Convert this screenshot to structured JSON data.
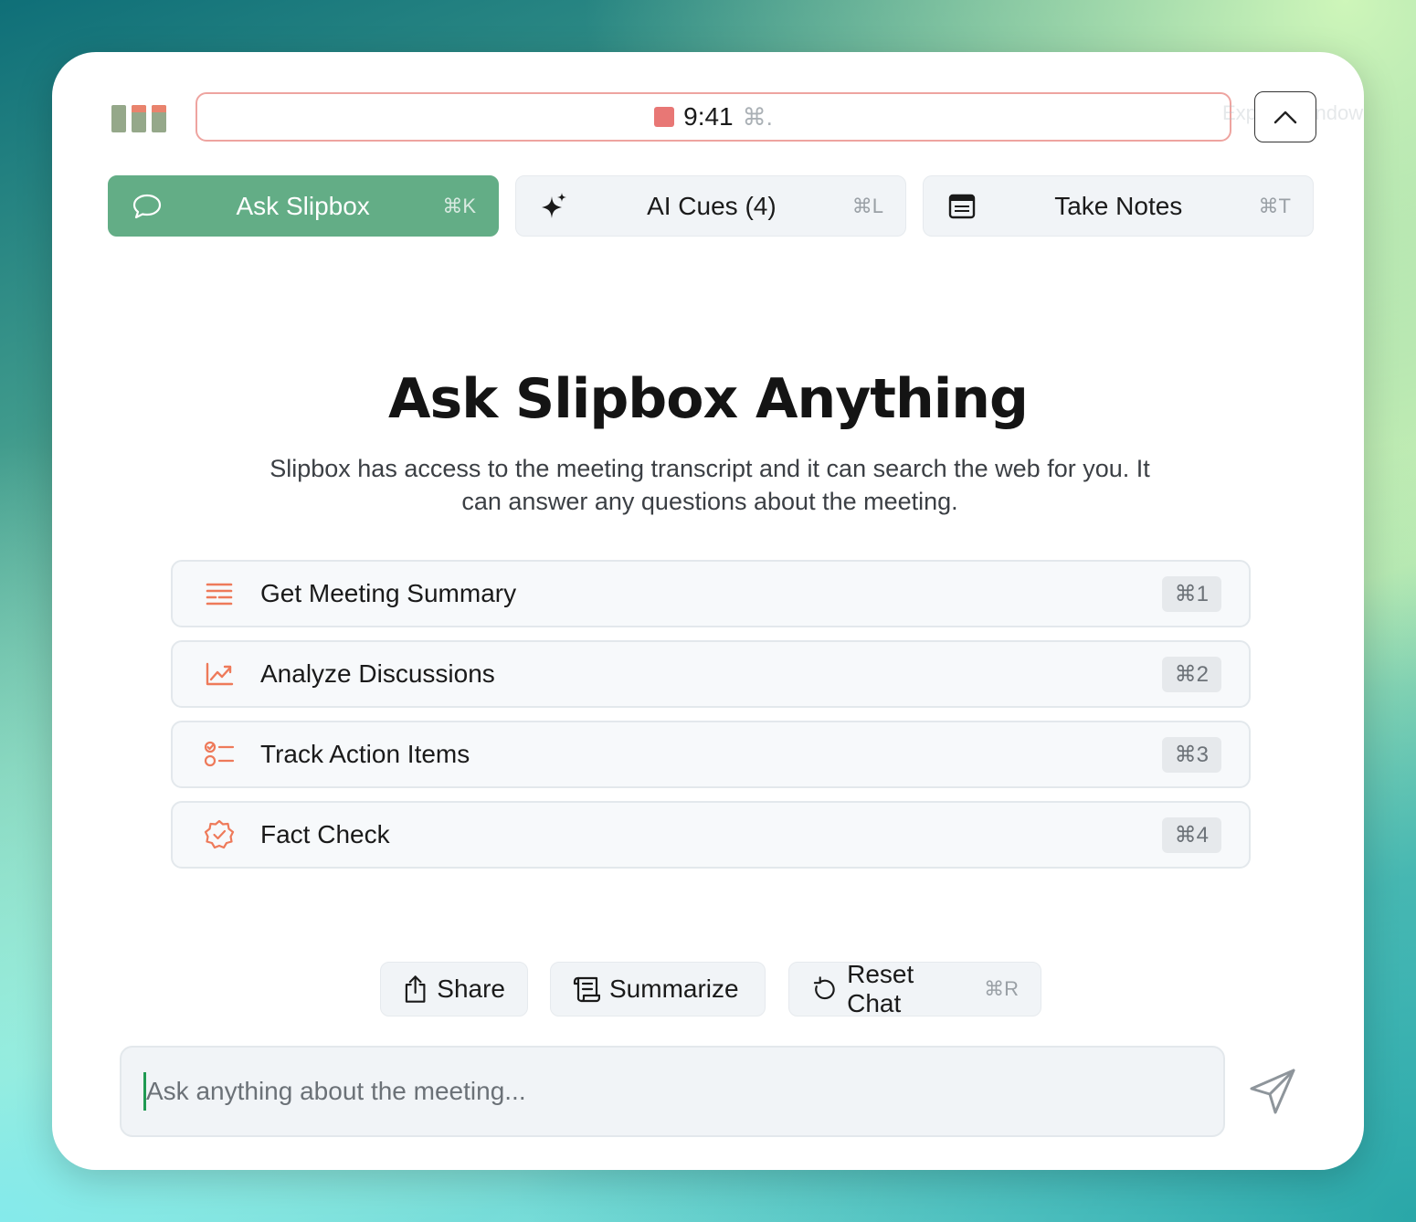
{
  "topbar": {
    "timer_time": "9:41",
    "timer_shortcut": "⌘.",
    "expand_tooltip": "Expand window"
  },
  "tabs": [
    {
      "label": "Ask Slipbox",
      "shortcut": "⌘K",
      "icon": "chat-bubble-icon",
      "active": true
    },
    {
      "label": "AI Cues (4)",
      "shortcut": "⌘L",
      "icon": "sparkle-icon",
      "active": false
    },
    {
      "label": "Take Notes",
      "shortcut": "⌘T",
      "icon": "notes-icon",
      "active": false
    }
  ],
  "hero": {
    "title": "Ask Slipbox Anything",
    "subtitle": "Slipbox has access to the meeting transcript and it can search the web for you. It can answer any questions about the meeting."
  },
  "options": [
    {
      "label": "Get Meeting Summary",
      "shortcut": "⌘1",
      "icon": "summary-lines-icon"
    },
    {
      "label": "Analyze Discussions",
      "shortcut": "⌘2",
      "icon": "trend-chart-icon"
    },
    {
      "label": "Track Action Items",
      "shortcut": "⌘3",
      "icon": "checklist-icon"
    },
    {
      "label": "Fact Check",
      "shortcut": "⌘4",
      "icon": "verified-badge-icon"
    }
  ],
  "actions": {
    "share": {
      "label": "Share",
      "icon": "share-icon"
    },
    "summarize": {
      "label": "Summarize",
      "icon": "scroll-icon"
    },
    "reset": {
      "label": "Reset Chat",
      "shortcut": "⌘R",
      "icon": "reset-icon"
    }
  },
  "chat": {
    "placeholder": "Ask anything about the meeting..."
  },
  "colors": {
    "accent_green": "#63ad86",
    "accent_orange": "#ee7a5a",
    "recording_red": "#e87775"
  }
}
